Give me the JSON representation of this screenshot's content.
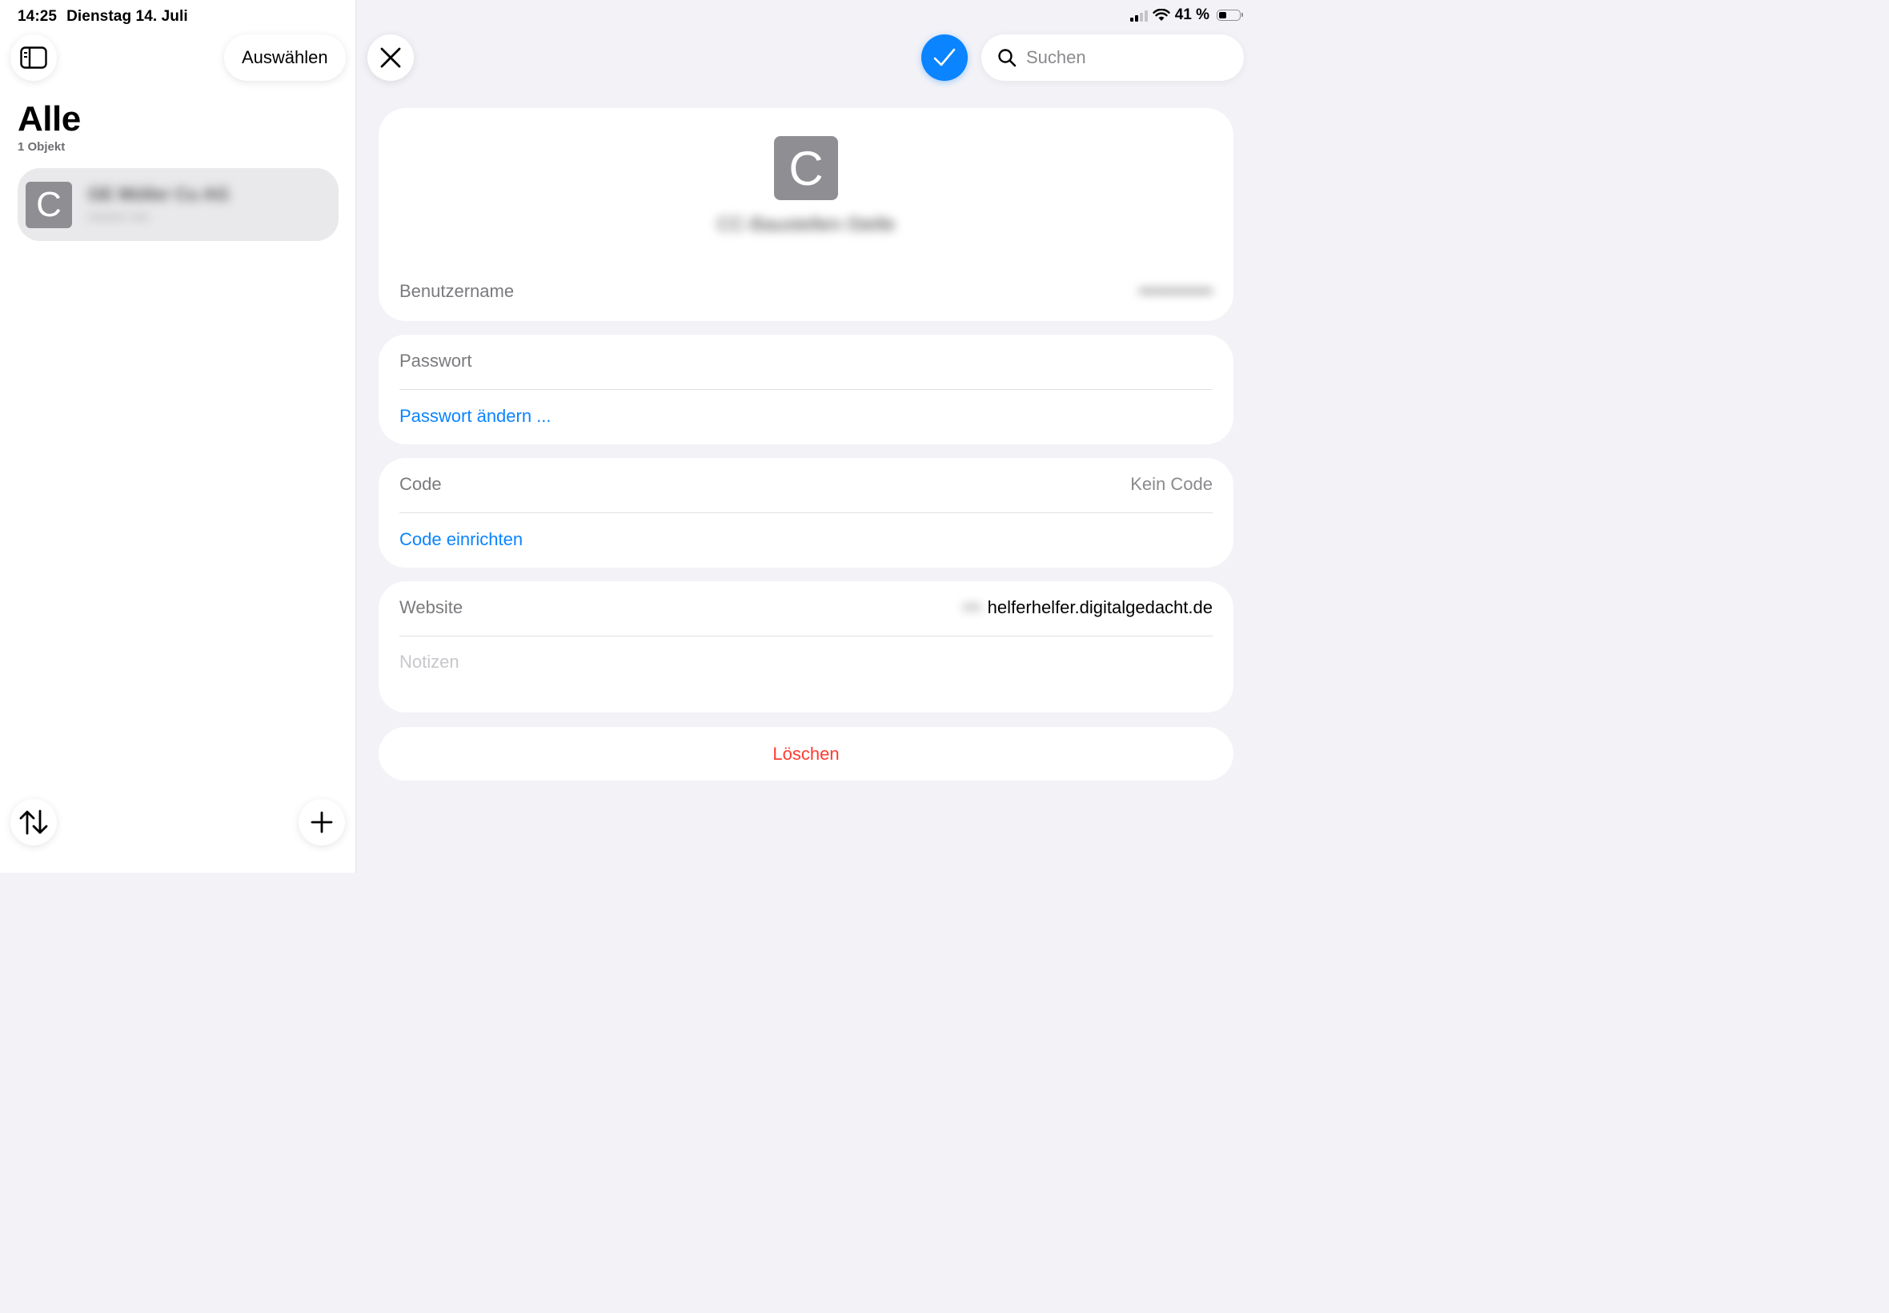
{
  "status_bar": {
    "time": "14:25",
    "date": "Dienstag 14. Juli",
    "battery_text": "41 %",
    "battery_level": 0.41
  },
  "sidebar": {
    "select_label": "Auswählen",
    "title": "Alle",
    "count": "1 Objekt",
    "items": [
      {
        "icon_letter": "C",
        "title": "GE Müller Cu AG",
        "subtitle": "•••••••• ••••"
      }
    ]
  },
  "toolbar": {
    "search_placeholder": "Suchen"
  },
  "detail": {
    "icon_letter": "C",
    "title": "CC-Baustellen-Stelle",
    "username_label": "Benutzername",
    "username_value": "••••••••••••",
    "password_label": "Passwort",
    "change_password_label": "Passwort ändern ...",
    "code_label": "Code",
    "code_value": "Kein Code",
    "setup_code_label": "Code einrichten",
    "website_label": "Website",
    "website_prefix": "•••",
    "website_value": "helferhelfer.digitalgedacht.de",
    "notes_placeholder": "Notizen",
    "delete_label": "Löschen"
  },
  "colors": {
    "accent": "#0a84ff",
    "destructive": "#ff3b30",
    "background": "#f2f2f7"
  }
}
